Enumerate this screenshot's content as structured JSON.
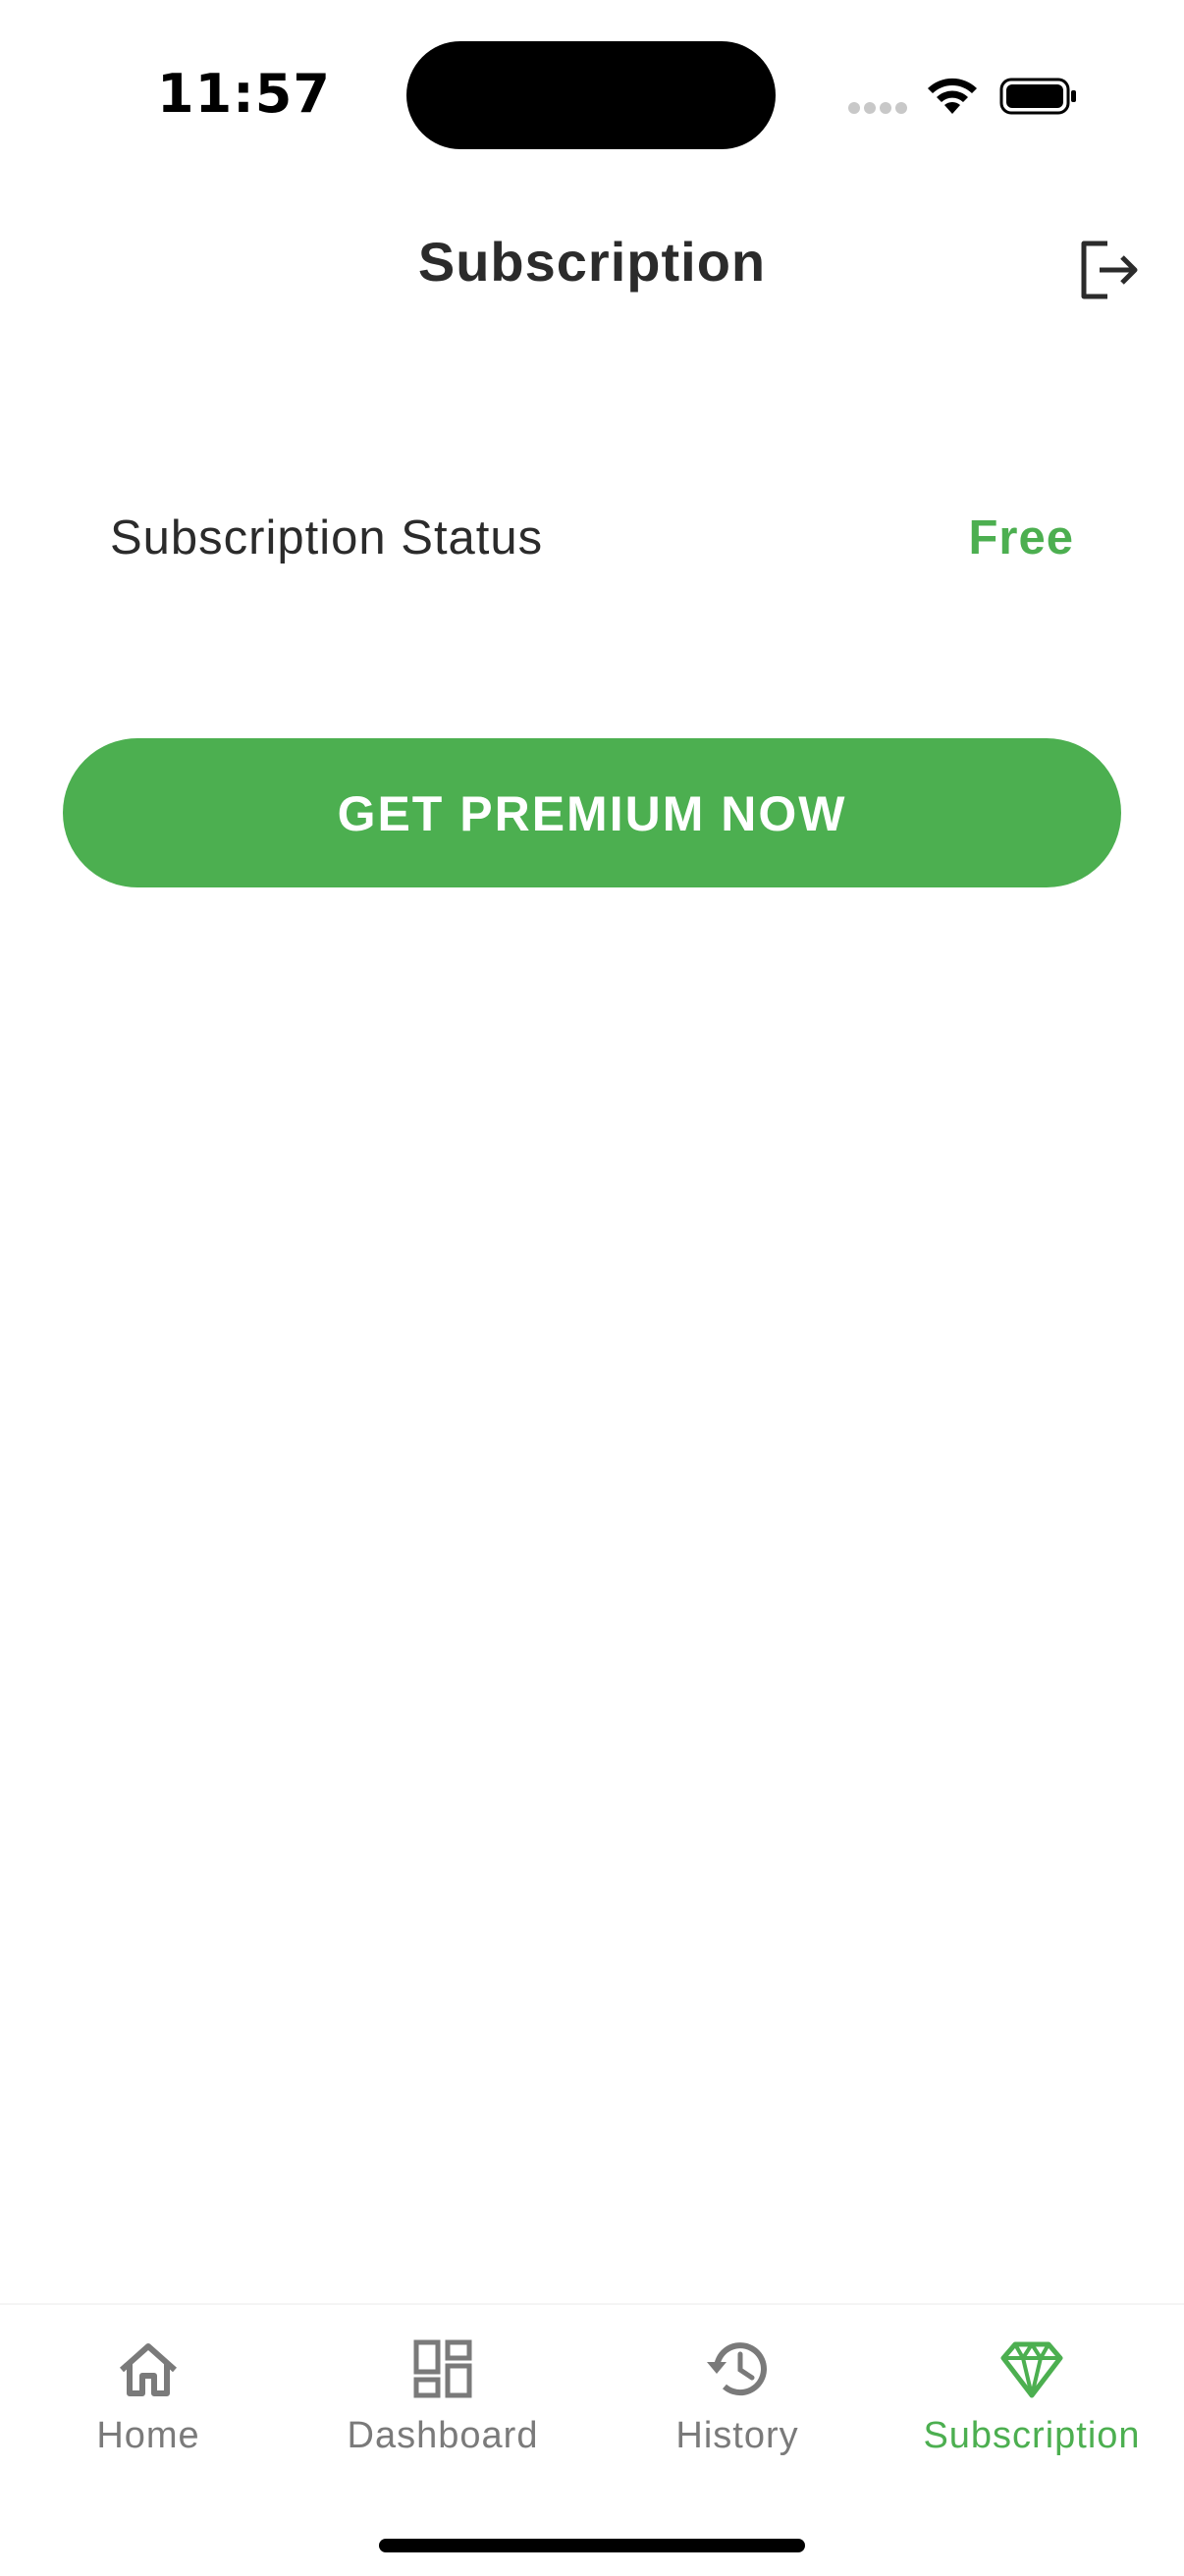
{
  "status_bar": {
    "time": "11:57"
  },
  "header": {
    "title": "Subscription",
    "logout_icon": "logout-icon"
  },
  "subscription": {
    "status_label": "Subscription Status",
    "status_value": "Free",
    "premium_button_label": "GET PREMIUM NOW"
  },
  "bottom_nav": {
    "items": [
      {
        "label": "Home",
        "icon": "home-icon",
        "active": false
      },
      {
        "label": "Dashboard",
        "icon": "dashboard-icon",
        "active": false
      },
      {
        "label": "History",
        "icon": "history-icon",
        "active": false
      },
      {
        "label": "Subscription",
        "icon": "diamond-icon",
        "active": true
      }
    ]
  },
  "colors": {
    "accent": "#4caf50",
    "text_primary": "#2b2b2b",
    "nav_inactive": "#7a7a7a",
    "background": "#ffffff"
  }
}
